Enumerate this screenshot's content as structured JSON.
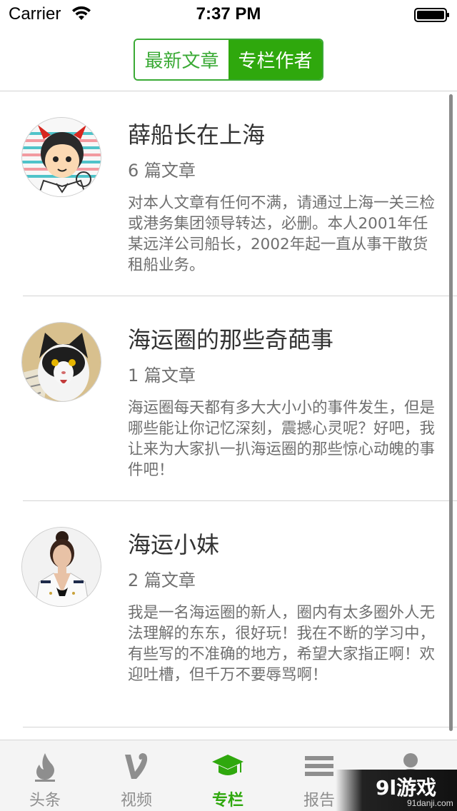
{
  "status_bar": {
    "carrier": "Carrier",
    "time": "7:37 PM"
  },
  "segmented_control": {
    "options": [
      "最新文章",
      "专栏作者"
    ],
    "selected": "专栏作者"
  },
  "authors": [
    {
      "name": "薛船长在上海",
      "article_count": "6 篇文章",
      "description": "对本人文章有任何不满，请通过上海一关三检或港务集团领导转达，必删。本人2001年任某远洋公司船长，2002年起一直从事干散货租船业务。",
      "avatar": "cartoon-devil-avatar"
    },
    {
      "name": "海运圈的那些奇葩事",
      "article_count": "1 篇文章",
      "description": "海运圈每天都有多大大小小的事件发生，但是哪些能让你记忆深刻，震撼心灵呢？好吧，我让来为大家扒一扒海运圈的那些惊心动魄的事件吧！",
      "avatar": "cat-photo-avatar"
    },
    {
      "name": "海运小妹",
      "article_count": "2 篇文章",
      "description": "我是一名海运圈的新人，圈内有太多圈外人无法理解的东东，很好玩！我在不断的学习中，有些写的不准确的地方，希望大家指正啊！欢迎吐槽，但千万不要辱骂啊！",
      "avatar": "woman-photo-avatar"
    }
  ],
  "tab_bar": {
    "tabs": [
      {
        "label": "头条",
        "icon": "flame-icon"
      },
      {
        "label": "视频",
        "icon": "vine-icon"
      },
      {
        "label": "专栏",
        "icon": "graduation-cap-icon"
      },
      {
        "label": "报告",
        "icon": "menu-lines-icon"
      },
      {
        "label": "",
        "icon": "person-icon"
      }
    ],
    "active": "专栏"
  },
  "watermark": {
    "logo": "9l游戏",
    "url": "91danji.com"
  },
  "colors": {
    "accent_green": "#2fa80d",
    "text_dark": "#333333",
    "text_gray": "#6f6f6f",
    "tab_inactive": "#8e8e8e"
  }
}
